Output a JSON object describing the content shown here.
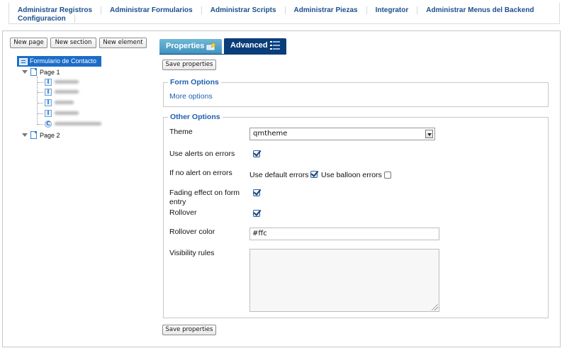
{
  "topnav": {
    "items": [
      "Administrar Registros",
      "Administrar Formularios",
      "Administrar Scripts",
      "Administrar Piezas",
      "Integrator",
      "Administrar Menus del Backend",
      "Configuracion"
    ]
  },
  "tree": {
    "toolbar": {
      "new_page": "New page",
      "new_section": "New section",
      "new_element": "New element"
    },
    "root": "Formulario de Contacto",
    "pages": [
      "Page 1",
      "Page 2"
    ]
  },
  "tabs": {
    "properties": "Properties",
    "advanced": "Advanced",
    "active": "Advanced"
  },
  "actions": {
    "save": "Save properties"
  },
  "form_options": {
    "legend": "Form Options",
    "more_options": "More options"
  },
  "other_options": {
    "legend": "Other Options",
    "theme": {
      "label": "Theme",
      "value": "qmtheme"
    },
    "use_alerts": {
      "label": "Use alerts on errors",
      "checked": true
    },
    "no_alert": {
      "label": "If no alert on errors",
      "use_default": {
        "label": "Use default errors",
        "checked": true
      },
      "use_balloon": {
        "label": "Use balloon errors",
        "checked": false
      }
    },
    "fading": {
      "label": "Fading effect on form entry",
      "checked": true
    },
    "rollover": {
      "label": "Rollover",
      "checked": true
    },
    "rollover_color": {
      "label": "Rollover color",
      "value": "#ffc"
    },
    "visibility_rules": {
      "label": "Visibility rules",
      "value": ""
    }
  },
  "colors": {
    "nav_link": "#1d4f8c",
    "tab_active": "#0b3d79",
    "tab_inactive": "#4a9ec6",
    "legend": "#1f5fae",
    "tree_selected": "#1c6dc8"
  }
}
